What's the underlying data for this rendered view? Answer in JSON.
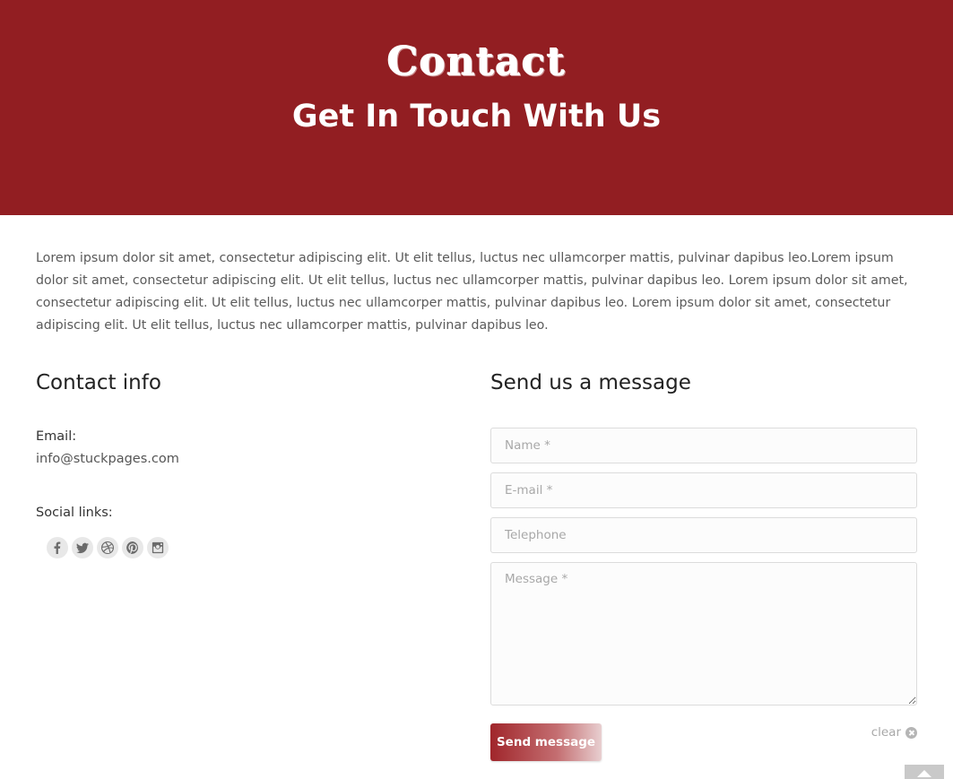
{
  "hero": {
    "title": "Contact",
    "subtitle": "Get In Touch With Us",
    "background_color": "#921e22"
  },
  "intro": {
    "text": "Lorem ipsum dolor sit amet, consectetur adipiscing elit. Ut elit tellus, luctus nec ullamcorper mattis, pulvinar dapibus leo.Lorem ipsum dolor sit amet, consectetur adipiscing elit. Ut elit tellus, luctus nec ullamcorper mattis, pulvinar dapibus leo. Lorem ipsum dolor sit amet, consectetur adipiscing elit. Ut elit tellus, luctus nec ullamcorper mattis, pulvinar dapibus leo. Lorem ipsum dolor sit amet, consectetur adipiscing elit. Ut elit tellus, luctus nec ullamcorper mattis, pulvinar dapibus leo."
  },
  "contact_info": {
    "heading": "Contact info",
    "email_label": "Email:",
    "email_value": "info@stuckpages.com",
    "social_label": "Social links:",
    "social_icons": [
      "facebook-icon",
      "twitter-icon",
      "dribbble-icon",
      "pinterest-icon",
      "instagram-icon"
    ]
  },
  "form": {
    "heading": "Send us a message",
    "name_placeholder": "Name *",
    "email_placeholder": "E-mail *",
    "telephone_placeholder": "Telephone",
    "message_placeholder": "Message *",
    "send_label": "Send message",
    "clear_label": "clear",
    "accent_color": "#a0262b"
  }
}
